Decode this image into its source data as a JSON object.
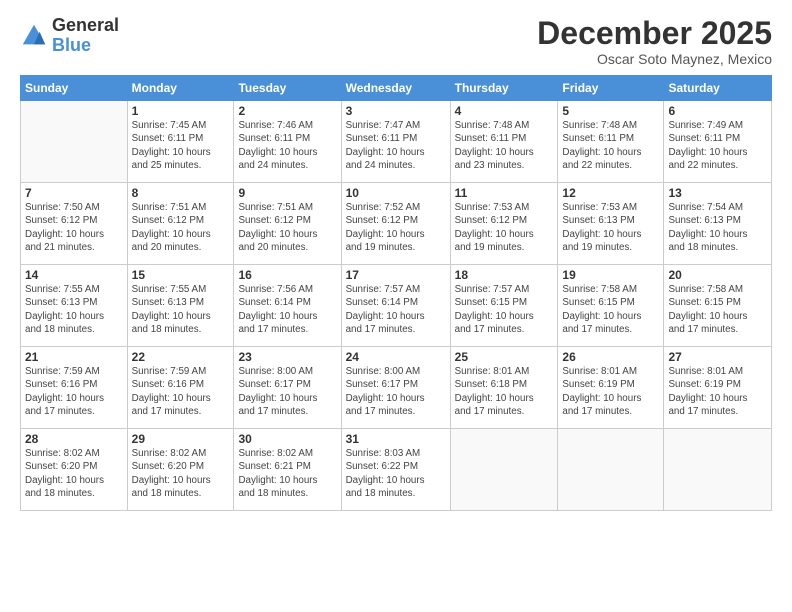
{
  "logo": {
    "general": "General",
    "blue": "Blue"
  },
  "header": {
    "month_title": "December 2025",
    "subtitle": "Oscar Soto Maynez, Mexico"
  },
  "weekdays": [
    "Sunday",
    "Monday",
    "Tuesday",
    "Wednesday",
    "Thursday",
    "Friday",
    "Saturday"
  ],
  "weeks": [
    [
      {
        "day": "",
        "info": ""
      },
      {
        "day": "1",
        "info": "Sunrise: 7:45 AM\nSunset: 6:11 PM\nDaylight: 10 hours\nand 25 minutes."
      },
      {
        "day": "2",
        "info": "Sunrise: 7:46 AM\nSunset: 6:11 PM\nDaylight: 10 hours\nand 24 minutes."
      },
      {
        "day": "3",
        "info": "Sunrise: 7:47 AM\nSunset: 6:11 PM\nDaylight: 10 hours\nand 24 minutes."
      },
      {
        "day": "4",
        "info": "Sunrise: 7:48 AM\nSunset: 6:11 PM\nDaylight: 10 hours\nand 23 minutes."
      },
      {
        "day": "5",
        "info": "Sunrise: 7:48 AM\nSunset: 6:11 PM\nDaylight: 10 hours\nand 22 minutes."
      },
      {
        "day": "6",
        "info": "Sunrise: 7:49 AM\nSunset: 6:11 PM\nDaylight: 10 hours\nand 22 minutes."
      }
    ],
    [
      {
        "day": "7",
        "info": "Sunrise: 7:50 AM\nSunset: 6:12 PM\nDaylight: 10 hours\nand 21 minutes."
      },
      {
        "day": "8",
        "info": "Sunrise: 7:51 AM\nSunset: 6:12 PM\nDaylight: 10 hours\nand 20 minutes."
      },
      {
        "day": "9",
        "info": "Sunrise: 7:51 AM\nSunset: 6:12 PM\nDaylight: 10 hours\nand 20 minutes."
      },
      {
        "day": "10",
        "info": "Sunrise: 7:52 AM\nSunset: 6:12 PM\nDaylight: 10 hours\nand 19 minutes."
      },
      {
        "day": "11",
        "info": "Sunrise: 7:53 AM\nSunset: 6:12 PM\nDaylight: 10 hours\nand 19 minutes."
      },
      {
        "day": "12",
        "info": "Sunrise: 7:53 AM\nSunset: 6:13 PM\nDaylight: 10 hours\nand 19 minutes."
      },
      {
        "day": "13",
        "info": "Sunrise: 7:54 AM\nSunset: 6:13 PM\nDaylight: 10 hours\nand 18 minutes."
      }
    ],
    [
      {
        "day": "14",
        "info": "Sunrise: 7:55 AM\nSunset: 6:13 PM\nDaylight: 10 hours\nand 18 minutes."
      },
      {
        "day": "15",
        "info": "Sunrise: 7:55 AM\nSunset: 6:13 PM\nDaylight: 10 hours\nand 18 minutes."
      },
      {
        "day": "16",
        "info": "Sunrise: 7:56 AM\nSunset: 6:14 PM\nDaylight: 10 hours\nand 17 minutes."
      },
      {
        "day": "17",
        "info": "Sunrise: 7:57 AM\nSunset: 6:14 PM\nDaylight: 10 hours\nand 17 minutes."
      },
      {
        "day": "18",
        "info": "Sunrise: 7:57 AM\nSunset: 6:15 PM\nDaylight: 10 hours\nand 17 minutes."
      },
      {
        "day": "19",
        "info": "Sunrise: 7:58 AM\nSunset: 6:15 PM\nDaylight: 10 hours\nand 17 minutes."
      },
      {
        "day": "20",
        "info": "Sunrise: 7:58 AM\nSunset: 6:15 PM\nDaylight: 10 hours\nand 17 minutes."
      }
    ],
    [
      {
        "day": "21",
        "info": "Sunrise: 7:59 AM\nSunset: 6:16 PM\nDaylight: 10 hours\nand 17 minutes."
      },
      {
        "day": "22",
        "info": "Sunrise: 7:59 AM\nSunset: 6:16 PM\nDaylight: 10 hours\nand 17 minutes."
      },
      {
        "day": "23",
        "info": "Sunrise: 8:00 AM\nSunset: 6:17 PM\nDaylight: 10 hours\nand 17 minutes."
      },
      {
        "day": "24",
        "info": "Sunrise: 8:00 AM\nSunset: 6:17 PM\nDaylight: 10 hours\nand 17 minutes."
      },
      {
        "day": "25",
        "info": "Sunrise: 8:01 AM\nSunset: 6:18 PM\nDaylight: 10 hours\nand 17 minutes."
      },
      {
        "day": "26",
        "info": "Sunrise: 8:01 AM\nSunset: 6:19 PM\nDaylight: 10 hours\nand 17 minutes."
      },
      {
        "day": "27",
        "info": "Sunrise: 8:01 AM\nSunset: 6:19 PM\nDaylight: 10 hours\nand 17 minutes."
      }
    ],
    [
      {
        "day": "28",
        "info": "Sunrise: 8:02 AM\nSunset: 6:20 PM\nDaylight: 10 hours\nand 18 minutes."
      },
      {
        "day": "29",
        "info": "Sunrise: 8:02 AM\nSunset: 6:20 PM\nDaylight: 10 hours\nand 18 minutes."
      },
      {
        "day": "30",
        "info": "Sunrise: 8:02 AM\nSunset: 6:21 PM\nDaylight: 10 hours\nand 18 minutes."
      },
      {
        "day": "31",
        "info": "Sunrise: 8:03 AM\nSunset: 6:22 PM\nDaylight: 10 hours\nand 18 minutes."
      },
      {
        "day": "",
        "info": ""
      },
      {
        "day": "",
        "info": ""
      },
      {
        "day": "",
        "info": ""
      }
    ]
  ]
}
